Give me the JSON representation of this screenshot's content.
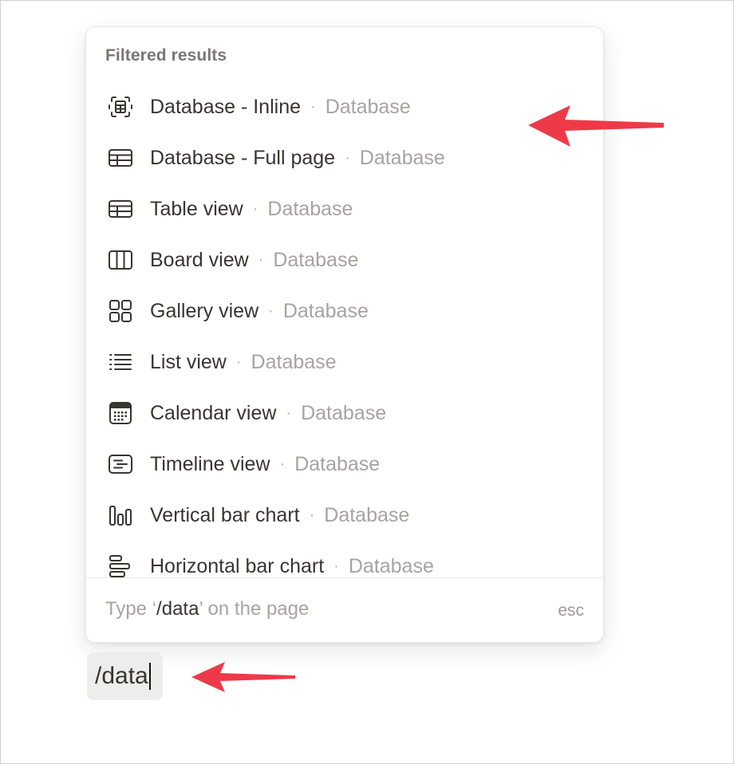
{
  "menu": {
    "header": "Filtered results",
    "separator": "·",
    "items": [
      {
        "label": "Database - Inline",
        "sub": "Database",
        "icon": "database-inline-icon"
      },
      {
        "label": "Database - Full page",
        "sub": "Database",
        "icon": "table-icon"
      },
      {
        "label": "Table view",
        "sub": "Database",
        "icon": "table-icon"
      },
      {
        "label": "Board view",
        "sub": "Database",
        "icon": "board-icon"
      },
      {
        "label": "Gallery view",
        "sub": "Database",
        "icon": "gallery-icon"
      },
      {
        "label": "List view",
        "sub": "Database",
        "icon": "list-icon"
      },
      {
        "label": "Calendar view",
        "sub": "Database",
        "icon": "calendar-icon"
      },
      {
        "label": "Timeline view",
        "sub": "Database",
        "icon": "timeline-icon"
      },
      {
        "label": "Vertical bar chart",
        "sub": "Database",
        "icon": "vertical-bar-chart-icon"
      },
      {
        "label": "Horizontal bar chart",
        "sub": "Database",
        "icon": "horizontal-bar-chart-icon"
      }
    ],
    "footer": {
      "prefix": "Type ",
      "open_quote": "‘",
      "command": "/data",
      "close_quote": "’",
      "suffix": " on the page",
      "esc": "esc"
    }
  },
  "editor": {
    "input_value": "/data"
  },
  "colors": {
    "annotation_arrow": "#ee3a48",
    "label_text": "#37352f",
    "muted_text": "#a5a49f"
  }
}
